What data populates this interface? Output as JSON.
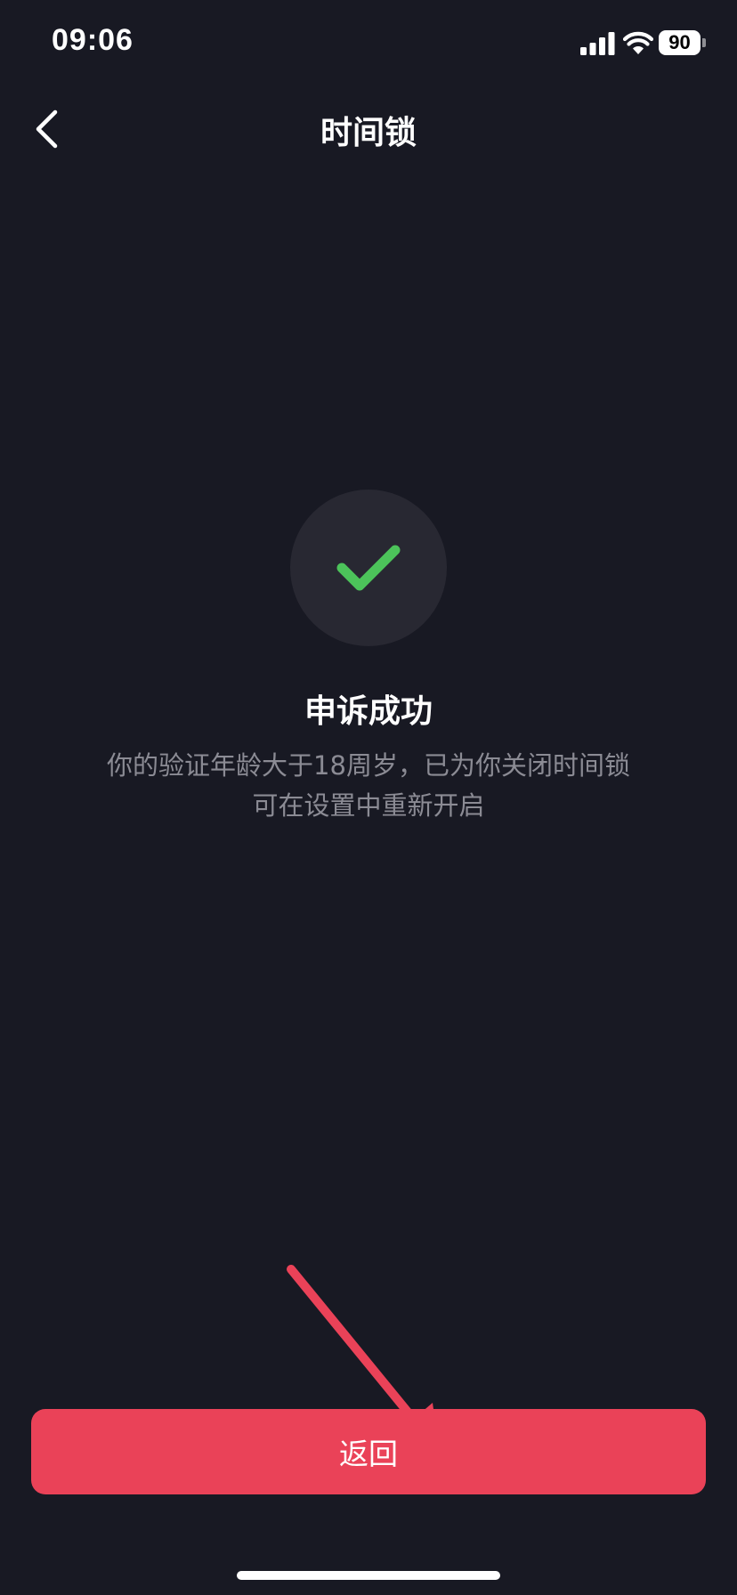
{
  "status_bar": {
    "time": "09:06",
    "battery_level": "90",
    "icons": [
      "signal-icon",
      "wifi-icon",
      "battery-icon"
    ]
  },
  "nav": {
    "title": "时间锁",
    "back_icon": "chevron-left-icon"
  },
  "result": {
    "icon": "checkmark-icon",
    "title": "申诉成功",
    "description_line1": "你的验证年龄大于18周岁，已为你关闭时间锁",
    "description_line2": "可在设置中重新开启"
  },
  "actions": {
    "return_label": "返回"
  },
  "colors": {
    "background": "#181923",
    "accent": "#ea4258",
    "success": "#4cc35a",
    "circle": "#282832",
    "secondary_text": "#8b8b94"
  }
}
